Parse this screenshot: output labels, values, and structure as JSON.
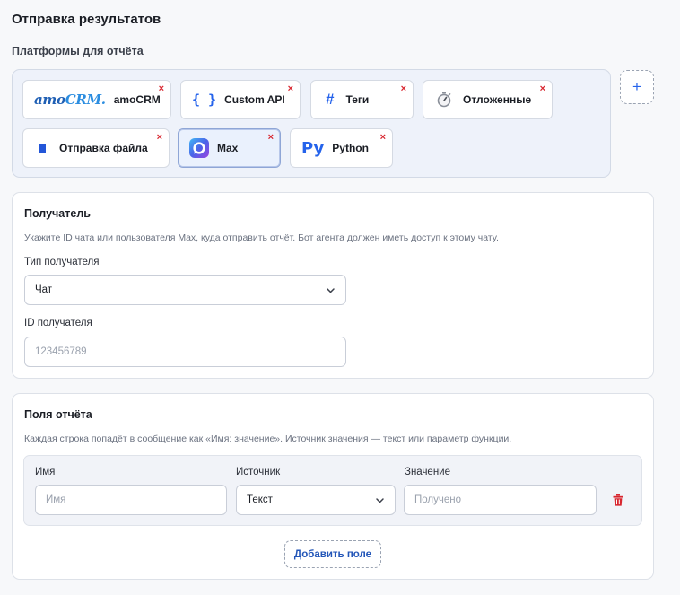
{
  "page": {
    "title": "Отправка результатов"
  },
  "platforms": {
    "label": "Платформы для отчёта",
    "remove_symbol": "×",
    "add_symbol": "+",
    "items": [
      {
        "label": "amoCRM",
        "logo_text_a": "amo",
        "logo_text_b": "CRM.",
        "icon": "amocrm-logo",
        "active": false
      },
      {
        "label": "Custom API",
        "icon_text": "{ }",
        "icon": "braces-icon",
        "active": false
      },
      {
        "label": "Теги",
        "icon_text": "#",
        "icon": "hash-icon",
        "active": false
      },
      {
        "label": "Отложенные",
        "icon": "stopwatch-icon",
        "active": false
      },
      {
        "label": "Отправка файла",
        "icon": "file-icon",
        "active": false
      },
      {
        "label": "Max",
        "icon": "max-logo",
        "active": true
      },
      {
        "label": "Python",
        "icon_text": "Py",
        "icon": "python-icon",
        "active": false
      }
    ]
  },
  "recipient": {
    "title": "Получатель",
    "description": "Укажите ID чата или пользователя Max, куда отправить отчёт. Бот агента должен иметь доступ к этому чату.",
    "type_label": "Тип получателя",
    "type_value": "Чат",
    "id_label": "ID получателя",
    "id_placeholder": "123456789"
  },
  "report_fields": {
    "title": "Поля отчёта",
    "description": "Каждая строка попадёт в сообщение как «Имя: значение». Источник значения — текст или параметр функции.",
    "columns": {
      "name": "Имя",
      "source": "Источник",
      "value": "Значение"
    },
    "rows": [
      {
        "name_placeholder": "Имя",
        "source_value": "Текст",
        "value_placeholder": "Получено"
      }
    ],
    "add_button": "Добавить поле"
  },
  "colors": {
    "accent": "#2563eb",
    "danger": "#d8262f",
    "chip_active_bg": "#eaf1fd"
  }
}
